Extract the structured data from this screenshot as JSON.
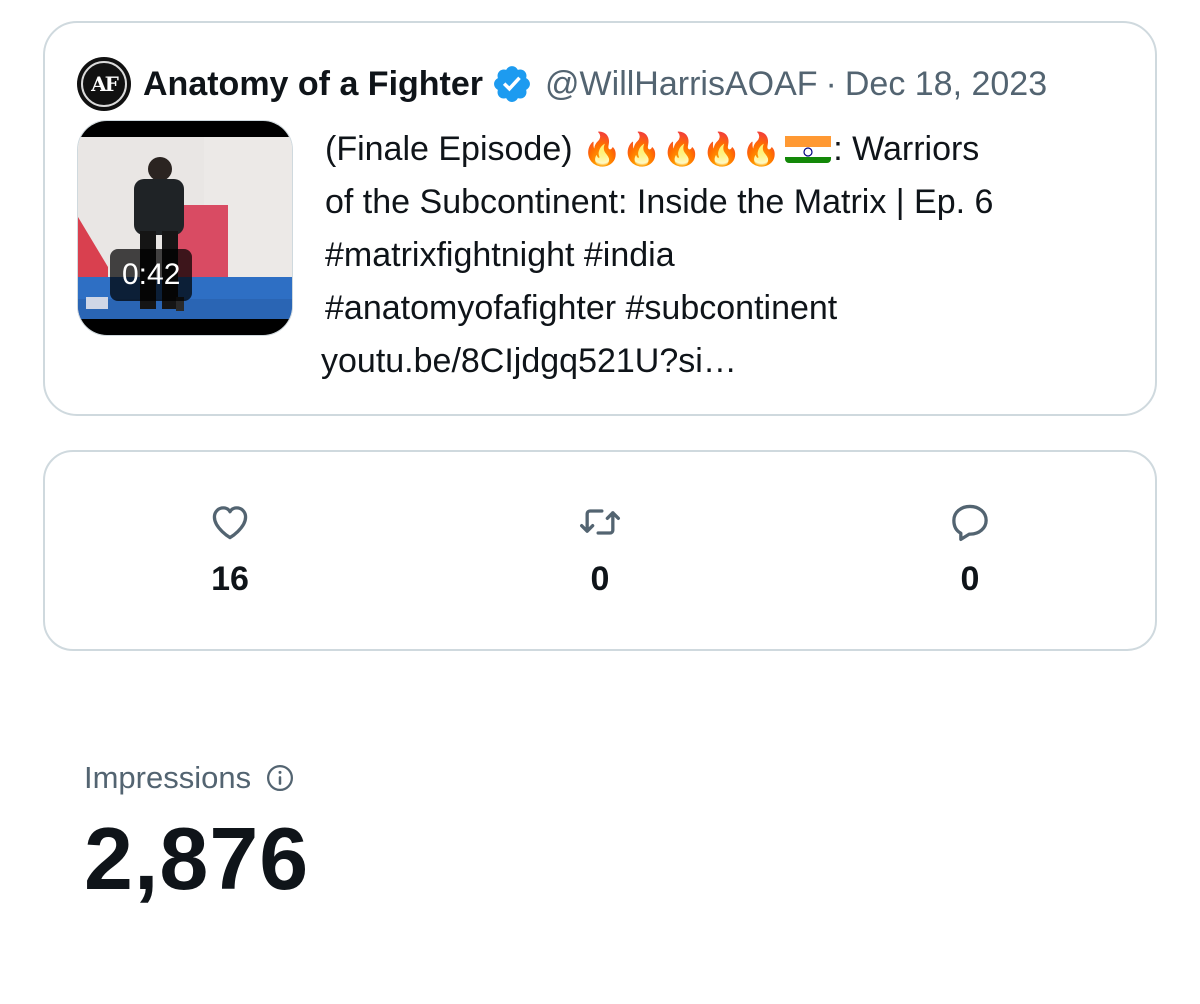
{
  "tweet": {
    "author_name": "Anatomy of a Fighter",
    "handle": "@WillHarrisAOAF",
    "separator": "·",
    "date": "Dec 18, 2023",
    "avatar_icon": "anatomy-of-a-fighter-logo",
    "verified_color": "#1d9bf0",
    "video_duration": "0:42",
    "text_lines": {
      "l1_prefix": "(Finale Episode) ",
      "l1_emojis": "🔥🔥🔥🔥🔥",
      "l1_suffix": ": Warriors",
      "l2": "of the Subcontinent: Inside the Matrix | Ep. 6",
      "l3": "#matrixfightnight #india",
      "l4": "#anatomyofafighter #subcontinent",
      "l5": "youtu.be/8CIjdgq521U?si…"
    }
  },
  "stats": {
    "likes": {
      "icon": "heart-icon",
      "value": "16"
    },
    "retweets": {
      "icon": "retweet-icon",
      "value": "0"
    },
    "replies": {
      "icon": "reply-icon",
      "value": "0"
    }
  },
  "impressions": {
    "label": "Impressions",
    "info_icon": "info-icon",
    "value": "2,876"
  },
  "colors": {
    "border": "#cfd9de",
    "text_primary": "#0f1419",
    "text_secondary": "#536471"
  }
}
